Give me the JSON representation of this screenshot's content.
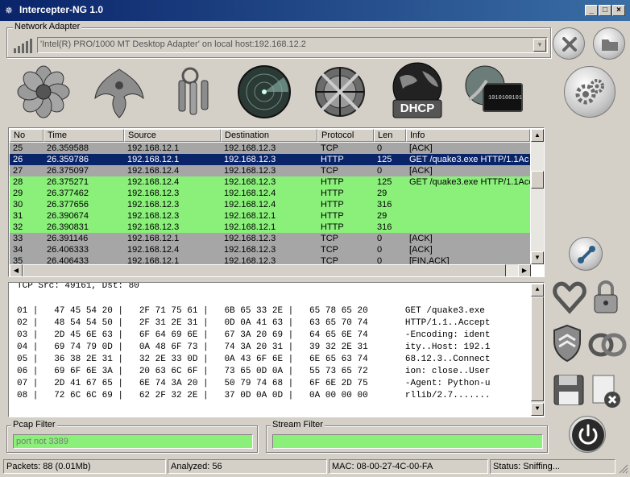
{
  "window": {
    "title": "Intercepter-NG 1.0"
  },
  "adapter": {
    "label": "Network Adapter",
    "value": "'Intel(R) PRO/1000 MT Desktop Adapter' on local host:192.168.12.2"
  },
  "tools": [
    {
      "name": "flower-icon"
    },
    {
      "name": "phoenix-icon"
    },
    {
      "name": "keys-icon"
    },
    {
      "name": "radar-icon"
    },
    {
      "name": "crosshair-icon"
    },
    {
      "name": "dhcp-globe-icon",
      "label": "DHCP"
    },
    {
      "name": "network-terminal-icon",
      "screen_text": "1010100101"
    }
  ],
  "table": {
    "columns": [
      "No",
      "Time",
      "Source",
      "Destination",
      "Protocol",
      "Len",
      "Info"
    ],
    "rows": [
      {
        "no": "25",
        "time": "26.359588",
        "src": "192.168.12.1",
        "dst": "192.168.12.3",
        "proto": "TCP",
        "len": "0",
        "info": "[ACK]",
        "color": "#a6a6a6"
      },
      {
        "no": "26",
        "time": "26.359786",
        "src": "192.168.12.1",
        "dst": "192.168.12.3",
        "proto": "HTTP",
        "len": "125",
        "info": "GET /quake3.exe HTTP/1.1Ac",
        "color": "#0a246a"
      },
      {
        "no": "27",
        "time": "26.375097",
        "src": "192.168.12.4",
        "dst": "192.168.12.3",
        "proto": "TCP",
        "len": "0",
        "info": "[ACK]",
        "color": "#a6a6a6"
      },
      {
        "no": "28",
        "time": "26.375271",
        "src": "192.168.12.4",
        "dst": "192.168.12.3",
        "proto": "HTTP",
        "len": "125",
        "info": "GET /quake3.exe HTTP/1.1Acc",
        "color": "#8af07a"
      },
      {
        "no": "29",
        "time": "26.377462",
        "src": "192.168.12.3",
        "dst": "192.168.12.4",
        "proto": "HTTP",
        "len": "29",
        "info": "",
        "color": "#8af07a"
      },
      {
        "no": "30",
        "time": "26.377656",
        "src": "192.168.12.3",
        "dst": "192.168.12.4",
        "proto": "HTTP",
        "len": "316",
        "info": "",
        "color": "#8af07a"
      },
      {
        "no": "31",
        "time": "26.390674",
        "src": "192.168.12.3",
        "dst": "192.168.12.1",
        "proto": "HTTP",
        "len": "29",
        "info": "",
        "color": "#8af07a"
      },
      {
        "no": "32",
        "time": "26.390831",
        "src": "192.168.12.3",
        "dst": "192.168.12.1",
        "proto": "HTTP",
        "len": "316",
        "info": "",
        "color": "#8af07a"
      },
      {
        "no": "33",
        "time": "26.391146",
        "src": "192.168.12.1",
        "dst": "192.168.12.3",
        "proto": "TCP",
        "len": "0",
        "info": "[ACK]",
        "color": "#a6a6a6"
      },
      {
        "no": "34",
        "time": "26.406333",
        "src": "192.168.12.4",
        "dst": "192.168.12.3",
        "proto": "TCP",
        "len": "0",
        "info": "[ACK]",
        "color": "#a6a6a6"
      },
      {
        "no": "35",
        "time": "26.406433",
        "src": "192.168.12.1",
        "dst": "192.168.12.3",
        "proto": "TCP",
        "len": "0",
        "info": "[FIN,ACK]",
        "color": "#a6a6a6"
      }
    ]
  },
  "hex": {
    "header": "TCP Src: 49161, Dst: 80",
    "lines": [
      "01 |   47 45 54 20 |   2F 71 75 61 |   6B 65 33 2E |   65 78 65 20       GET /quake3.exe",
      "02 |   48 54 54 50 |   2F 31 2E 31 |   0D 0A 41 63 |   63 65 70 74       HTTP/1.1..Accept",
      "03 |   2D 45 6E 63 |   6F 64 69 6E |   67 3A 20 69 |   64 65 6E 74       -Encoding: ident",
      "04 |   69 74 79 0D |   0A 48 6F 73 |   74 3A 20 31 |   39 32 2E 31       ity..Host: 192.1",
      "05 |   36 38 2E 31 |   32 2E 33 0D |   0A 43 6F 6E |   6E 65 63 74       68.12.3..Connect",
      "06 |   69 6F 6E 3A |   20 63 6C 6F |   73 65 0D 0A |   55 73 65 72       ion: close..User",
      "07 |   2D 41 67 65 |   6E 74 3A 20 |   50 79 74 68 |   6F 6E 2D 75       -Agent: Python-u",
      "08 |   72 6C 6C 69 |   62 2F 32 2E |   37 0D 0A 0D |   0A 00 00 00       rllib/2.7......."
    ]
  },
  "filters": {
    "pcap": {
      "label": "Pcap Filter",
      "value": "port not 3389"
    },
    "stream": {
      "label": "Stream Filter",
      "value": ""
    }
  },
  "status": {
    "packets": "Packets: 88 (0.01Mb)",
    "analyzed": "Analyzed: 56",
    "mac": "MAC: 08-00-27-4C-00-FA",
    "state": "Status: Sniffing..."
  }
}
